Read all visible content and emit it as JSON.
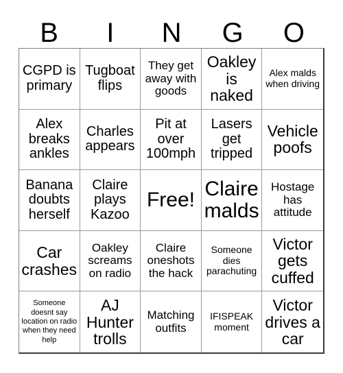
{
  "card": {
    "header_letters": [
      "B",
      "I",
      "N",
      "G",
      "O"
    ],
    "columns": 5,
    "rows": 5,
    "colors": {
      "background": "#ffffff",
      "text": "#000000",
      "grid_line": "#9a9a9a",
      "grid_outer": "#3a3a3a"
    },
    "cells": [
      {
        "text": "CGPD is primary",
        "size": "lg"
      },
      {
        "text": "Tugboat flips",
        "size": "lg"
      },
      {
        "text": "They get away with goods",
        "size": "md"
      },
      {
        "text": "Oakley is naked",
        "size": "xl"
      },
      {
        "text": "Alex malds when driving",
        "size": "sm"
      },
      {
        "text": "Alex breaks ankles",
        "size": "lg"
      },
      {
        "text": "Charles appears",
        "size": "lg"
      },
      {
        "text": "Pit at over 100mph",
        "size": "lg"
      },
      {
        "text": "Lasers get tripped",
        "size": "lg"
      },
      {
        "text": "Vehicle poofs",
        "size": "xl"
      },
      {
        "text": "Banana doubts herself",
        "size": "lg"
      },
      {
        "text": "Claire plays Kazoo",
        "size": "lg"
      },
      {
        "text": "Free!",
        "size": "xxl"
      },
      {
        "text": "Claire malds",
        "size": "xxl"
      },
      {
        "text": "Hostage has attitude",
        "size": "md"
      },
      {
        "text": "Car crashes",
        "size": "xl"
      },
      {
        "text": "Oakley screams on radio",
        "size": "md"
      },
      {
        "text": "Claire oneshots the hack",
        "size": "md"
      },
      {
        "text": "Someone dies parachuting",
        "size": "sm"
      },
      {
        "text": "Victor gets cuffed",
        "size": "xl"
      },
      {
        "text": "Someone doesnt say location on radio when they need help",
        "size": "xs"
      },
      {
        "text": "AJ Hunter trolls",
        "size": "xl"
      },
      {
        "text": "Matching outfits",
        "size": "md"
      },
      {
        "text": "IFISPEAK moment",
        "size": "sm"
      },
      {
        "text": "Victor drives a car",
        "size": "xl"
      }
    ]
  }
}
